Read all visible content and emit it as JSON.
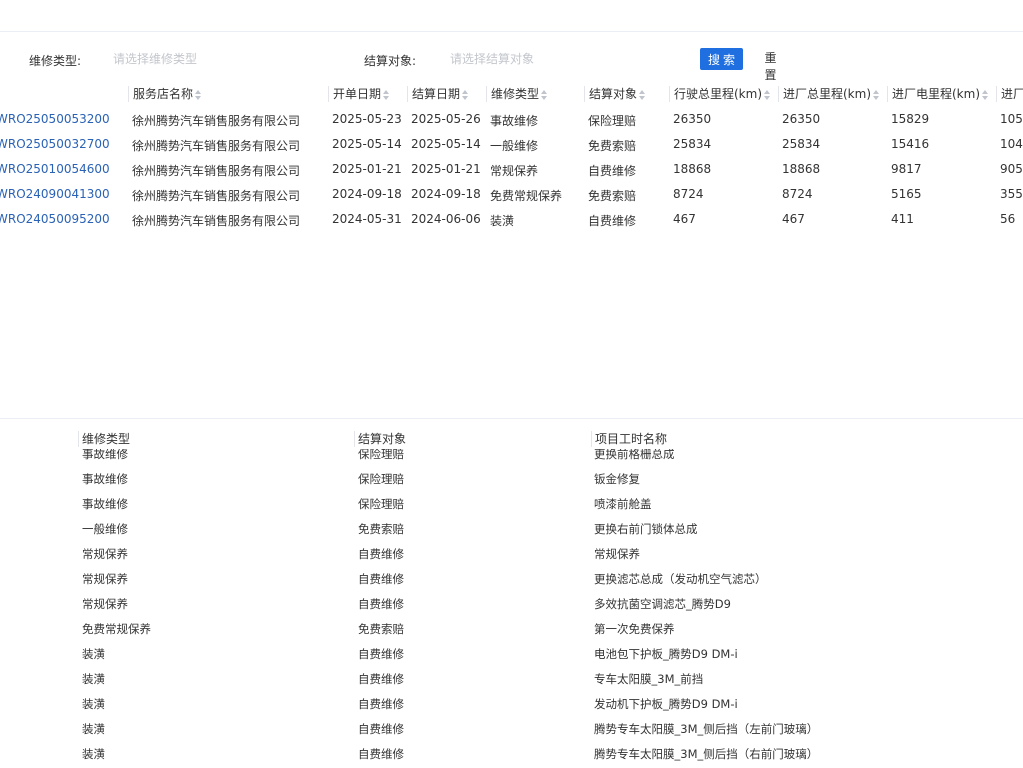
{
  "filter": {
    "repair_type_label": "维修类型:",
    "repair_type_placeholder": "请选择维修类型",
    "settlement_label": "结算对象:",
    "settlement_placeholder": "请选择结算对象",
    "search_button": "搜索",
    "reset_button": "重置"
  },
  "orders": {
    "columns": [
      "服务店名称",
      "开单日期",
      "结算日期",
      "维修类型",
      "结算对象",
      "行驶总里程(km)",
      "进厂总里程(km)",
      "进厂电里程(km)",
      "进厂"
    ],
    "rows": [
      [
        "WRO25050053200",
        "徐州腾势汽车销售服务有限公司",
        "2025-05-23",
        "2025-05-26",
        "事故维修",
        "保险理赔",
        "26350",
        "26350",
        "15829",
        "105"
      ],
      [
        "WRO25050032700",
        "徐州腾势汽车销售服务有限公司",
        "2025-05-14",
        "2025-05-14",
        "一般维修",
        "免费索赔",
        "25834",
        "25834",
        "15416",
        "104"
      ],
      [
        "WRO25010054600",
        "徐州腾势汽车销售服务有限公司",
        "2025-01-21",
        "2025-01-21",
        "常规保养",
        "自费维修",
        "18868",
        "18868",
        "9817",
        "905"
      ],
      [
        "WRO24090041300",
        "徐州腾势汽车销售服务有限公司",
        "2024-09-18",
        "2024-09-18",
        "免费常规保养",
        "免费索赔",
        "8724",
        "8724",
        "5165",
        "355"
      ],
      [
        "WRO24050095200",
        "徐州腾势汽车销售服务有限公司",
        "2024-05-31",
        "2024-06-06",
        "装潢",
        "自费维修",
        "467",
        "467",
        "411",
        "56"
      ]
    ]
  },
  "items": {
    "columns": [
      "维修类型",
      "结算对象",
      "项目工时名称"
    ],
    "rows": [
      [
        "事故维修",
        "保险理赔",
        "更换前格栅总成"
      ],
      [
        "事故维修",
        "保险理赔",
        "钣金修复"
      ],
      [
        "事故维修",
        "保险理赔",
        "喷漆前舱盖"
      ],
      [
        "一般维修",
        "免费索赔",
        "更换右前门锁体总成"
      ],
      [
        "常规保养",
        "自费维修",
        "常规保养"
      ],
      [
        "常规保养",
        "自费维修",
        "更换滤芯总成（发动机空气滤芯）"
      ],
      [
        "常规保养",
        "自费维修",
        "多效抗菌空调滤芯_腾势D9"
      ],
      [
        "免费常规保养",
        "免费索赔",
        "第一次免费保养"
      ],
      [
        "装潢",
        "自费维修",
        "电池包下护板_腾势D9 DM-i"
      ],
      [
        "装潢",
        "自费维修",
        "专车太阳膜_3M_前挡"
      ],
      [
        "装潢",
        "自费维修",
        "发动机下护板_腾势D9 DM-i"
      ],
      [
        "装潢",
        "自费维修",
        "腾势专车太阳膜_3M_侧后挡（左前门玻璃）"
      ],
      [
        "装潢",
        "自费维修",
        "腾势专车太阳膜_3M_侧后挡（右前门玻璃）"
      ]
    ]
  },
  "colors": {
    "primary": "#1f6fe0",
    "link": "#2a62b5"
  }
}
